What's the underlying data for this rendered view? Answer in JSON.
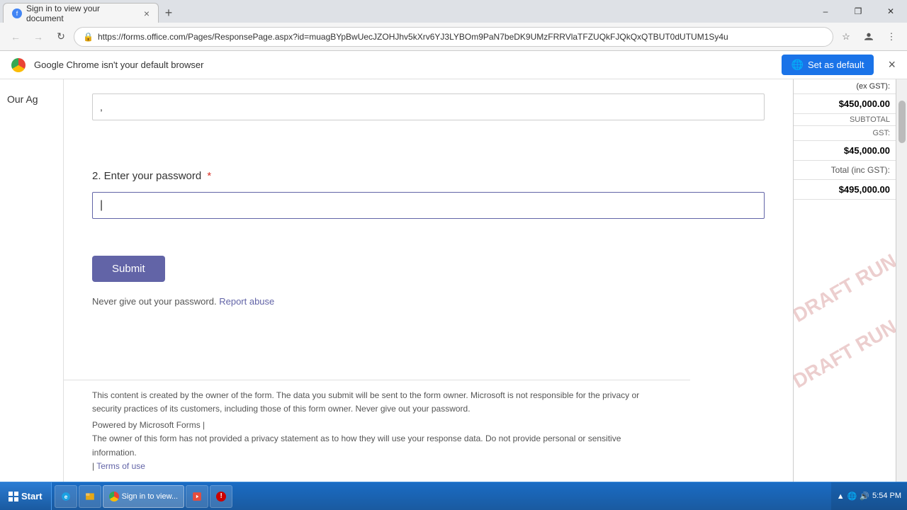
{
  "browser": {
    "tab_title": "Sign in to view your document",
    "tab_close_icon": "×",
    "new_tab_icon": "+",
    "win_minimize": "–",
    "win_maximize": "❐",
    "win_close": "✕",
    "url": "https://forms.office.com/Pages/ResponsePage.aspx?id=muagBYpBwUecJZOHJhv5kXrv6YJ3LYBOm9PaN7beDK9UMzFRRVlaTFZUQkFJQkQxQTBUT0dUTUM1Sy4u",
    "nav_back": "←",
    "nav_forward": "→",
    "nav_refresh": "↻",
    "star_icon": "☆",
    "profile_icon": "👤",
    "menu_icon": "⋮"
  },
  "default_banner": {
    "text": "Google Chrome isn't your default browser",
    "button_label": "Set as default",
    "close_icon": "×"
  },
  "form": {
    "side_label": "Our Ag",
    "question2_label": "2. Enter your password",
    "question2_required": "*",
    "submit_label": "Submit",
    "warning_text": "Never give out your password.",
    "report_link": "Report abuse",
    "input1_value": ",",
    "input2_value": "|",
    "input2_placeholder": ""
  },
  "right_panel": {
    "header": "(ex GST):",
    "rows": [
      {
        "label": "",
        "value": ""
      },
      {
        "label": "Total (inc GST):",
        "value": "$495,000.00"
      }
    ],
    "amount1": "$450,000.00",
    "amount2": "$45,000.00",
    "label1": "SUBTOTAL",
    "label2": "GST:",
    "watermark1": "DRAFT RUN",
    "watermark2": "DRAFT RUN"
  },
  "footer": {
    "line1": "This content is created by the owner of the form. The data you submit will be sent to the form owner. Microsoft is not responsible for the privacy or security practices of its customers, including those of this form owner. Never give out your password.",
    "line2": "Powered by Microsoft Forms |",
    "line3": "The owner of this form has not provided a privacy statement as to how they will use your response data. Do not provide personal or sensitive information.",
    "terms_link": "Terms of use",
    "terms_prefix": "| "
  },
  "taskbar": {
    "start_label": "Start",
    "app_buttons": [
      {
        "label": "Sign in to view..."
      }
    ],
    "tray_time": "5:54 PM",
    "tray_icons": [
      "🔊",
      "🌐",
      "⬆"
    ]
  }
}
